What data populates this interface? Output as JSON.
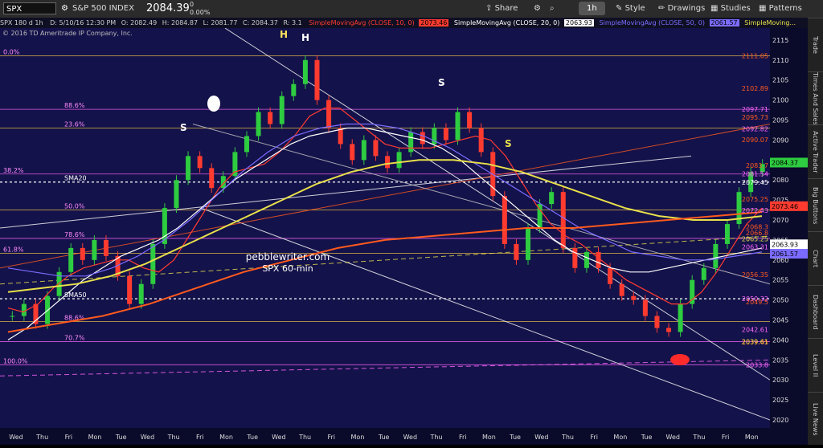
{
  "toolbar": {
    "symbol": "SPX",
    "index_name": "S&P 500 INDEX",
    "last_price": "2084.39",
    "change": "0",
    "change_pct": "0.00%",
    "share": "Share",
    "timeframe": "1h",
    "style": "Style",
    "drawings": "Drawings",
    "studies": "Studies",
    "patterns": "Patterns"
  },
  "infobar": {
    "period": "SPX 180 d 1h",
    "date": "D: 5/10/16 12:30 PM",
    "open": "O: 2082.49",
    "high": "H: 2084.87",
    "low": "L: 2081.77",
    "close": "C: 2084.37",
    "range": "R: 3.1",
    "sma10_label": "SimpleMovingAvg (CLOSE, 10, 0)",
    "sma10_value": "2073.46",
    "sma20_label": "SimpleMovingAvg (CLOSE, 20, 0)",
    "sma20_value": "2063.93",
    "sma50_label": "SimpleMovingAvg (CLOSE, 50, 0)",
    "sma50_value": "2061.57",
    "more": "SimpleMoving..."
  },
  "sidebar": [
    "Trade",
    "Times And Sales",
    "Active Trader",
    "Big Buttons",
    "Chart",
    "Dashboard",
    "Level II",
    "Live News"
  ],
  "copyright": "© 2016 TD Ameritrade IP Company, Inc.",
  "watermark": {
    "line1": "pebblewriter.com",
    "line2": "SPX 60-min"
  },
  "colors": {
    "sma10": "#ff3b30",
    "sma20": "#ffffff",
    "sma50": "#7b6cff",
    "sma100": "#e8e04a",
    "sma200": "#ff5a1e",
    "fib": "#ff66ff",
    "channel": "#ffffff",
    "background": "#14124a"
  },
  "chart_data": {
    "type": "candlestick",
    "ylim": [
      2018,
      2118
    ],
    "y_ticks": [
      2020,
      2025,
      2030,
      2035,
      2040,
      2045,
      2050,
      2055,
      2060,
      2065,
      2070,
      2075,
      2080,
      2085,
      2090,
      2095,
      2100,
      2105,
      2110,
      2115
    ],
    "x_days": [
      "Wed",
      "Thu",
      "Fri",
      "Mon",
      "Tue",
      "Wed",
      "Thu",
      "Fri",
      "Mon",
      "Tue",
      "Wed",
      "Thu",
      "Fri",
      "Mon",
      "Tue",
      "Wed",
      "Thu",
      "Fri",
      "Mon",
      "Tue",
      "Wed",
      "Thu",
      "Fri",
      "Mon",
      "Tue",
      "Wed",
      "Thu",
      "Fri",
      "Mon"
    ],
    "closes": [
      2046,
      2049,
      2044,
      2051,
      2057,
      2063,
      2060,
      2065,
      2061,
      2056,
      2049,
      2054,
      2064,
      2073,
      2080,
      2086,
      2083,
      2078,
      2081,
      2087,
      2091,
      2097,
      2094,
      2101,
      2104,
      2110,
      2100,
      2093,
      2089,
      2085,
      2090,
      2086,
      2083,
      2087,
      2092,
      2089,
      2093,
      2090,
      2097,
      2093,
      2087,
      2076,
      2064,
      2060,
      2068,
      2074,
      2077,
      2063,
      2058,
      2062,
      2058,
      2054,
      2051,
      2050,
      2046,
      2043,
      2042,
      2049,
      2055,
      2058,
      2064,
      2069,
      2077,
      2082,
      2084
    ],
    "sma_series": [
      {
        "name": "SMA10",
        "color": "#ff3b30",
        "values": [
          2048,
          2047,
          2049,
          2053,
          2056,
          2058,
          2059,
          2060,
          2060,
          2058,
          2057,
          2060,
          2066,
          2072,
          2078,
          2082,
          2083,
          2084,
          2087,
          2091,
          2096,
          2098,
          2098,
          2095,
          2092,
          2089,
          2088,
          2088,
          2088,
          2089,
          2090,
          2091,
          2090,
          2086,
          2080,
          2074,
          2069,
          2066,
          2064,
          2061,
          2058,
          2055,
          2053,
          2051,
          2049,
          2049,
          2052,
          2057,
          2063,
          2069,
          2073
        ]
      },
      {
        "name": "SMA20",
        "color": "#ffffff",
        "values": [
          2040,
          2043,
          2047,
          2051,
          2055,
          2058,
          2061,
          2063,
          2065,
          2068,
          2072,
          2076,
          2080,
          2083,
          2086,
          2089,
          2091,
          2092,
          2093,
          2093,
          2092,
          2091,
          2090,
          2088,
          2085,
          2081,
          2077,
          2073,
          2069,
          2065,
          2062,
          2060,
          2058,
          2057,
          2057,
          2058,
          2059,
          2060,
          2061,
          2062,
          2063
        ]
      },
      {
        "name": "SMA50",
        "color": "#7b6cff",
        "values": [
          2058,
          2057,
          2056,
          2056,
          2058,
          2061,
          2065,
          2070,
          2076,
          2082,
          2087,
          2091,
          2093,
          2094,
          2094,
          2093,
          2091,
          2088,
          2084,
          2080,
          2076,
          2072,
          2068,
          2065,
          2062,
          2061,
          2060,
          2060,
          2061,
          2062
        ]
      },
      {
        "name": "SMA100",
        "color": "#e8e04a",
        "values": [
          2052,
          2053,
          2054,
          2056,
          2059,
          2063,
          2067,
          2071,
          2075,
          2079,
          2082,
          2084,
          2085,
          2085,
          2084,
          2082,
          2079,
          2076,
          2073,
          2071,
          2070,
          2070,
          2071
        ]
      },
      {
        "name": "SMA200",
        "color": "#ff5a1e",
        "values": [
          2042,
          2044,
          2046,
          2049,
          2053,
          2057,
          2060,
          2063,
          2065,
          2066,
          2067,
          2068,
          2068,
          2069,
          2070,
          2071,
          2072
        ]
      }
    ],
    "price_labels": [
      {
        "text": "2115",
        "value": 2115
      },
      {
        "text": "2111.05",
        "value": 2111.05
      },
      {
        "text": "2110",
        "value": 2110
      },
      {
        "text": "2105",
        "value": 2105
      },
      {
        "text": "2102.89",
        "value": 2102.89
      },
      {
        "text": "2100",
        "value": 2100
      },
      {
        "text": "2097.71",
        "value": 2097.71
      },
      {
        "text": "2095.73",
        "value": 2095.73
      },
      {
        "text": "2095",
        "value": 2095
      },
      {
        "text": "2092.82",
        "value": 2092.82
      },
      {
        "text": "2090.07",
        "value": 2090.07
      },
      {
        "text": "2090",
        "value": 2090
      },
      {
        "text": "2085",
        "value": 2085
      },
      {
        "text": "2084.37",
        "value": 2084.37
      },
      {
        "text": "2083.7",
        "value": 2083.7
      },
      {
        "text": "2081.54",
        "value": 2081.54
      },
      {
        "text": "2080",
        "value": 2080
      },
      {
        "text": "2079.45",
        "value": 2079.45
      },
      {
        "text": "2075",
        "value": 2075
      },
      {
        "text": "2075.25",
        "value": 2075.25
      },
      {
        "text": "2073.46",
        "value": 2073.46
      },
      {
        "text": "2072.43",
        "value": 2072.43
      },
      {
        "text": "2070",
        "value": 2070
      },
      {
        "text": "2068.3",
        "value": 2068.3
      },
      {
        "text": "2066.8",
        "value": 2066.8
      },
      {
        "text": "2065",
        "value": 2065
      },
      {
        "text": "2065.25",
        "value": 2065.25
      },
      {
        "text": "2063.93",
        "value": 2063.93
      },
      {
        "text": "2063.31",
        "value": 2063.31
      },
      {
        "text": "2061.57",
        "value": 2061.57
      },
      {
        "text": "2060",
        "value": 2060
      },
      {
        "text": "2056.35",
        "value": 2056.35
      },
      {
        "text": "2055",
        "value": 2055
      },
      {
        "text": "2050.32",
        "value": 2050.32
      },
      {
        "text": "2049.5",
        "value": 2049.5
      },
      {
        "text": "2050",
        "value": 2050
      },
      {
        "text": "2045",
        "value": 2045
      },
      {
        "text": "2042.61",
        "value": 2042.61
      },
      {
        "text": "2040",
        "value": 2040
      },
      {
        "text": "2039.45",
        "value": 2039.45
      },
      {
        "text": "2039.61",
        "value": 2039.61
      },
      {
        "text": "2035",
        "value": 2035
      },
      {
        "text": "2033.8",
        "value": 2033.8
      },
      {
        "text": "2030",
        "value": 2030
      },
      {
        "text": "2025",
        "value": 2025
      },
      {
        "text": "2020",
        "value": 2020
      }
    ],
    "fib_labels": [
      {
        "text": "0.0%",
        "value": 2111.05
      },
      {
        "text": "88.6%",
        "value": 2097.7
      },
      {
        "text": "23.6%",
        "value": 2093
      },
      {
        "text": "38.2%",
        "value": 2081.5
      },
      {
        "text": "50.0%",
        "value": 2072.5
      },
      {
        "text": "78.6%",
        "value": 2065.4
      },
      {
        "text": "61.8%",
        "value": 2061.7
      },
      {
        "text": "70.7%",
        "value": 2039.6
      },
      {
        "text": "88.6%",
        "value": 2044.6
      },
      {
        "text": "100.0%",
        "value": 2033.8
      },
      {
        "text": "SMA20",
        "value": 2079.5
      },
      {
        "text": "SMA50",
        "value": 2050.3
      }
    ],
    "annotations": [
      "H",
      "H",
      "S",
      "S",
      "S"
    ]
  }
}
